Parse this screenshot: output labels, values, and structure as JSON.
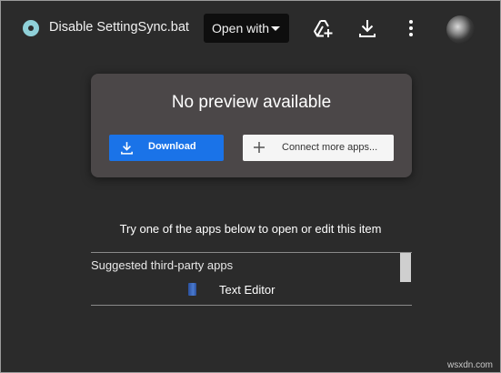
{
  "header": {
    "file_title": "Disable SettingSync.bat",
    "open_with_label": "Open with",
    "icons": [
      "file-type-icon",
      "add-shortcut-to-drive-icon",
      "download-icon",
      "more-options-icon",
      "avatar"
    ]
  },
  "preview": {
    "title": "No preview available",
    "download_label": "Download",
    "connect_label": "Connect more apps..."
  },
  "suggestions": {
    "hint": "Try one of the apps below to open or edit this item",
    "heading": "Suggested third-party apps",
    "apps": [
      {
        "name": "Text Editor",
        "icon": "text-editor-icon"
      }
    ]
  },
  "watermark": "wsxdn.com",
  "colors": {
    "background": "#2b2b2b",
    "card": "#4b4748",
    "primary_button": "#1a73e8",
    "secondary_button": "#f5f5f5",
    "open_with_bg": "#0e0e0e"
  }
}
